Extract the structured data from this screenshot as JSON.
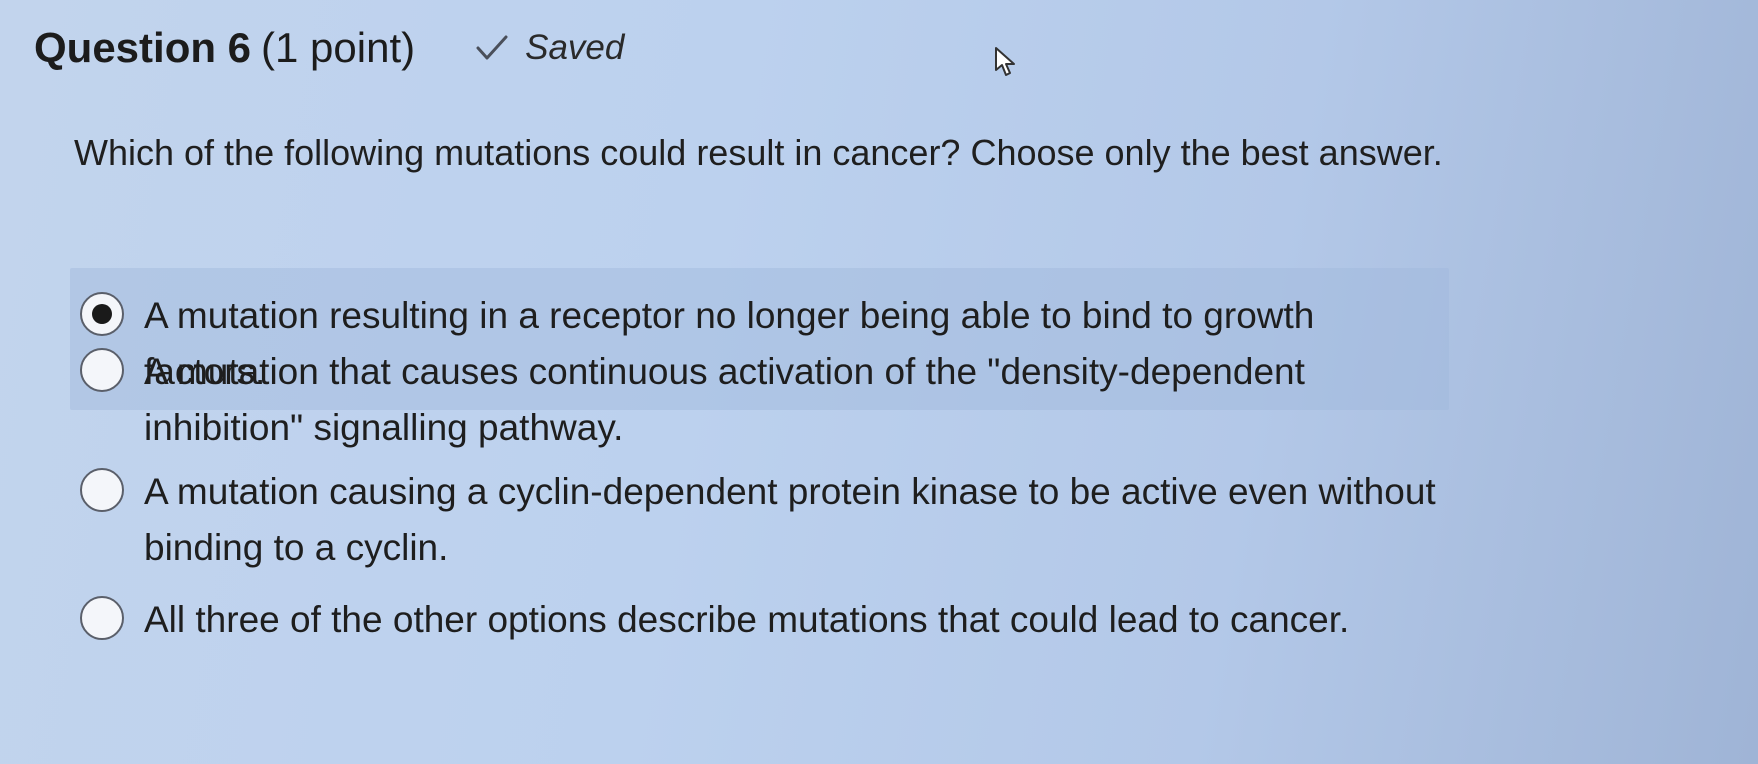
{
  "header": {
    "question_title": "Question 6",
    "points": "(1 point)",
    "status": "Saved"
  },
  "icons": {
    "status": "checkmark-icon",
    "pointer": "mouse-cursor-icon"
  },
  "question": {
    "text": "Which of the following mutations could result in cancer? Choose only the best answer."
  },
  "options": [
    {
      "label": "A mutation resulting in a receptor no longer being able to bind to growth factors.",
      "selected": true
    },
    {
      "label": "A mutation that causes continuous activation of the \"density-dependent inhibition\" signalling pathway.",
      "selected": false
    },
    {
      "label": "A mutation causing a cyclin-dependent protein kinase to be active even without binding to a cyclin.",
      "selected": false
    },
    {
      "label": "All three of the other options describe mutations that could lead to cancer.",
      "selected": false
    }
  ]
}
